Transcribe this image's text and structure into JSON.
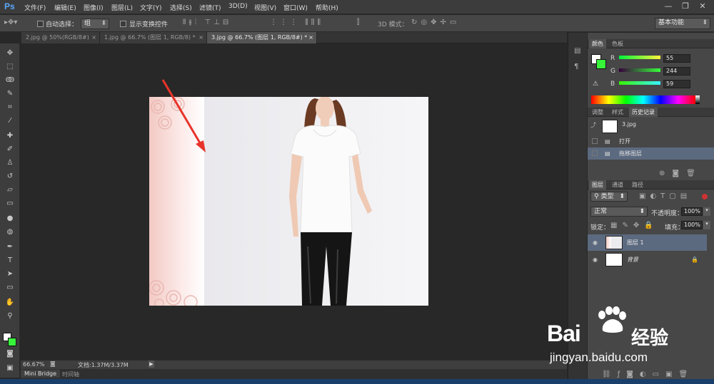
{
  "app": {
    "logo": "Ps",
    "workspace": "基本功能"
  },
  "menu": [
    "文件(F)",
    "编辑(E)",
    "图像(I)",
    "图层(L)",
    "文字(Y)",
    "选择(S)",
    "滤镜(T)",
    "3D(D)",
    "视图(V)",
    "窗口(W)",
    "帮助(H)"
  ],
  "window_controls": {
    "minimize": "—",
    "restore": "❐",
    "close": "✕"
  },
  "options": {
    "auto_select_label": "自动选择：",
    "auto_select_value": "组",
    "transform_label": "显示变换控件",
    "mode_3d_label": "3D 模式："
  },
  "tabs": [
    {
      "label": "2.jpg @ 50%(RGB/8#)",
      "close": "×"
    },
    {
      "label": "1.jpg @ 66.7% (图层 1, RGB/8) *",
      "close": "×"
    },
    {
      "label": "3.jpg @ 66.7% (图层 1, RGB/8#) *",
      "close": "×"
    }
  ],
  "status": {
    "zoom": "66.67%",
    "doc": "文档:1.37M/3.37M"
  },
  "bottom_tabs": [
    "Mini Bridge",
    "时间轴"
  ],
  "color_panel": {
    "tabs": [
      "颜色",
      "色板"
    ],
    "channels": [
      {
        "label": "R",
        "value": "55"
      },
      {
        "label": "G",
        "value": "244"
      },
      {
        "label": "B",
        "value": "59"
      }
    ],
    "foreground": "#37f43b",
    "background": "#ffffff"
  },
  "history_panel": {
    "tabs": [
      "调整",
      "样式",
      "历史记录"
    ],
    "snapshot": "3.jpg",
    "items": [
      "打开",
      "拖移图层"
    ]
  },
  "layers_panel": {
    "tabs": [
      "图层",
      "通道",
      "路径"
    ],
    "kind": "类型",
    "blend_mode": "正常",
    "opacity_label": "不透明度：",
    "opacity": "100%",
    "lock_label": "锁定：",
    "fill_label": "填充：",
    "fill": "100%",
    "layers": [
      {
        "name": "图层 1",
        "selected": true
      },
      {
        "name": "背景",
        "selected": false
      }
    ]
  },
  "watermark": {
    "brand": "Bai",
    "brand2": "经验",
    "url": "jingyan.baidu.com"
  }
}
